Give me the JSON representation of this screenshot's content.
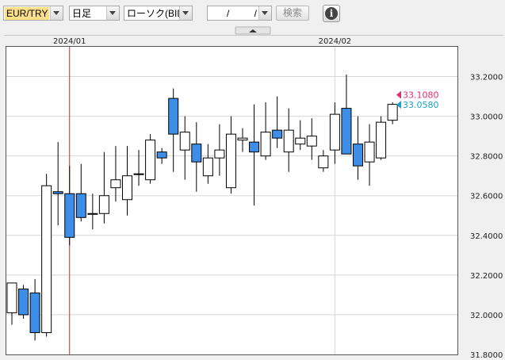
{
  "toolbar": {
    "pair": "EUR/TRY",
    "period": "日足",
    "chart_kind": "ローソク(BID)",
    "date_input": "/ /",
    "search_label": "検索",
    "info_glyph": "i"
  },
  "colors": {
    "pair_highlight": "#ffe08a",
    "bull_fill": "#ffffff",
    "bear_fill": "#3d8ee8",
    "grid": "#d8d8d8",
    "vline": "#cc2a2a",
    "ask_marker": "#e0306a",
    "bid_marker": "#1aa3c8"
  },
  "chart_data": {
    "type": "candlestick",
    "date_labels": [
      {
        "label": "2024/01",
        "index": 5
      },
      {
        "label": "2024/02",
        "index": 28
      }
    ],
    "ylim": [
      31.8,
      33.35
    ],
    "yticks": [
      "33.2000",
      "33.0000",
      "32.8000",
      "32.6000",
      "32.4000",
      "32.2000",
      "32.0000",
      "31.8000"
    ],
    "current_ask": "33.1080",
    "current_bid": "33.0580",
    "candles": [
      {
        "o": 32.01,
        "h": 32.12,
        "l": 31.95,
        "c": 32.16
      },
      {
        "o": 32.13,
        "h": 32.15,
        "l": 31.98,
        "c": 32.0
      },
      {
        "o": 32.11,
        "h": 32.18,
        "l": 31.87,
        "c": 31.91
      },
      {
        "o": 31.91,
        "h": 32.71,
        "l": 31.89,
        "c": 32.65
      },
      {
        "o": 32.62,
        "h": 32.87,
        "l": 32.45,
        "c": 32.61
      },
      {
        "o": 32.61,
        "h": 32.75,
        "l": 32.35,
        "c": 32.39
      },
      {
        "o": 32.61,
        "h": 32.76,
        "l": 32.47,
        "c": 32.49
      },
      {
        "o": 32.51,
        "h": 32.61,
        "l": 32.43,
        "c": 32.51
      },
      {
        "o": 32.51,
        "h": 32.82,
        "l": 32.46,
        "c": 32.6
      },
      {
        "o": 32.64,
        "h": 32.85,
        "l": 32.57,
        "c": 32.68
      },
      {
        "o": 32.58,
        "h": 32.85,
        "l": 32.5,
        "c": 32.7
      },
      {
        "o": 32.71,
        "h": 32.83,
        "l": 32.65,
        "c": 32.71
      },
      {
        "o": 32.68,
        "h": 32.91,
        "l": 32.66,
        "c": 32.88
      },
      {
        "o": 32.82,
        "h": 32.84,
        "l": 32.76,
        "c": 32.79
      },
      {
        "o": 33.09,
        "h": 33.14,
        "l": 32.72,
        "c": 32.91
      },
      {
        "o": 32.83,
        "h": 33.0,
        "l": 32.68,
        "c": 32.92
      },
      {
        "o": 32.86,
        "h": 32.97,
        "l": 32.62,
        "c": 32.77
      },
      {
        "o": 32.7,
        "h": 32.86,
        "l": 32.66,
        "c": 32.79
      },
      {
        "o": 32.79,
        "h": 32.96,
        "l": 32.7,
        "c": 32.83
      },
      {
        "o": 32.64,
        "h": 33.0,
        "l": 32.61,
        "c": 32.91
      },
      {
        "o": 32.88,
        "h": 32.94,
        "l": 32.82,
        "c": 32.89
      },
      {
        "o": 32.87,
        "h": 33.06,
        "l": 32.55,
        "c": 32.82
      },
      {
        "o": 32.8,
        "h": 33.07,
        "l": 32.78,
        "c": 32.92
      },
      {
        "o": 32.93,
        "h": 33.1,
        "l": 32.84,
        "c": 32.89
      },
      {
        "o": 32.82,
        "h": 33.04,
        "l": 32.72,
        "c": 32.93
      },
      {
        "o": 32.86,
        "h": 32.98,
        "l": 32.83,
        "c": 32.89
      },
      {
        "o": 32.85,
        "h": 32.99,
        "l": 32.78,
        "c": 32.9
      },
      {
        "o": 32.74,
        "h": 32.83,
        "l": 32.72,
        "c": 32.8
      },
      {
        "o": 32.83,
        "h": 33.07,
        "l": 32.76,
        "c": 33.01
      },
      {
        "o": 33.04,
        "h": 33.21,
        "l": 32.81,
        "c": 32.81
      },
      {
        "o": 32.86,
        "h": 33.0,
        "l": 32.68,
        "c": 32.75
      },
      {
        "o": 32.77,
        "h": 32.96,
        "l": 32.65,
        "c": 32.87
      },
      {
        "o": 32.79,
        "h": 33.0,
        "l": 32.78,
        "c": 32.97
      },
      {
        "o": 32.98,
        "h": 33.07,
        "l": 32.96,
        "c": 33.06
      }
    ]
  }
}
